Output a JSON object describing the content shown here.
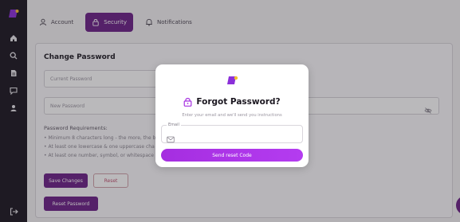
{
  "sidebar": {
    "icons": [
      "app-logo-icon",
      "home-icon",
      "search-icon",
      "document-icon",
      "chat-icon",
      "user-icon",
      "logout-icon"
    ]
  },
  "tabs": [
    {
      "label": "Account",
      "icon": "user-icon"
    },
    {
      "label": "Security",
      "icon": "lock-icon",
      "active": true
    },
    {
      "label": "Notifications",
      "icon": "bell-icon"
    }
  ],
  "change_password": {
    "title": "Change Password",
    "current_placeholder": "Current Password",
    "new_placeholder": "New Password",
    "requirements_title": "Password Requirements:",
    "requirements": [
      "Minimum 8 characters long - the more, the b",
      "At least one lowercase & one uppercase cha",
      "At least one number, symbol, or whitespace"
    ],
    "save_label": "Save Changes",
    "reset_label": "Reset",
    "reset_password_label": "Reset Password"
  },
  "modal": {
    "title": "Forgot Password?",
    "subtitle": "Enter your email and we'll send you instructions",
    "email_label": "Email",
    "email_value": "",
    "button_label": "Send reset Code"
  },
  "colors": {
    "primary": "#6b1f86",
    "accent": "#b43cf0",
    "sidebar": "#1a1520",
    "logo_yellow": "#f2c230",
    "logo_purple": "#8b2fd9"
  }
}
